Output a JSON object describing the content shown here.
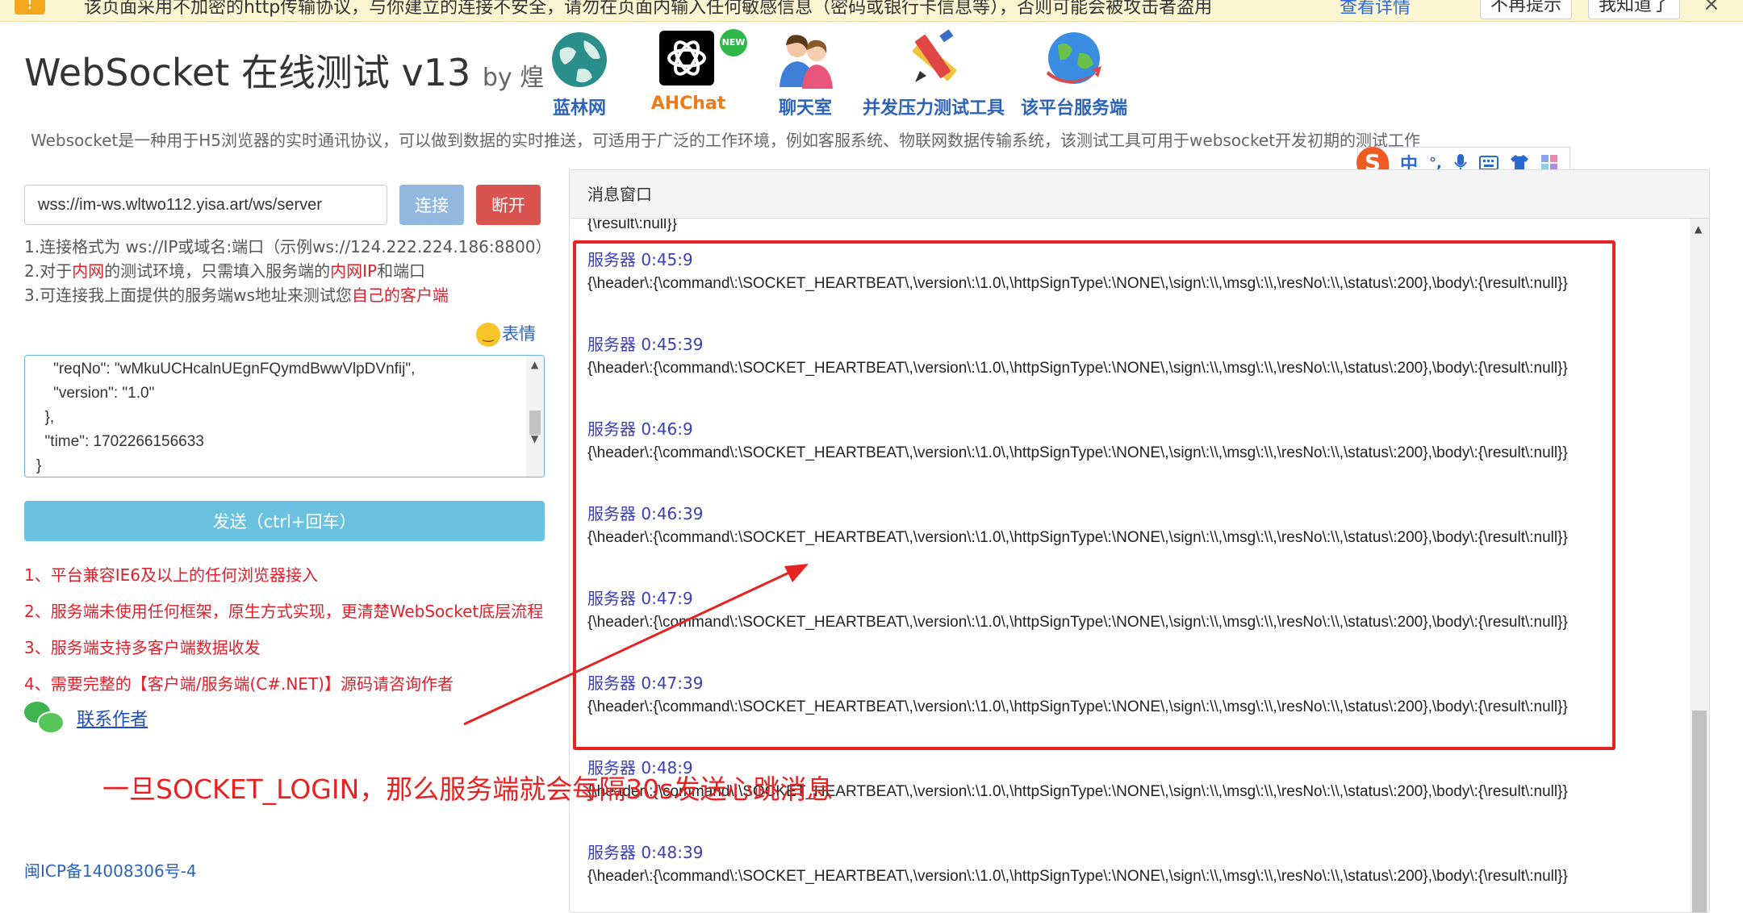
{
  "warning_bar": {
    "text": "该页面采用不加密的http传输协议，与你建立的连接不安全，请勿在页面内输入任何敏感信息（密码或银行卡信息等），否则可能会被攻击者盗用",
    "details_link": "查看详情",
    "no_remind_button": "不再提示",
    "got_it_button": "我知道了",
    "close_glyph": "×"
  },
  "header": {
    "title": "WebSocket 在线测试 v13",
    "by": "by 煌",
    "nav": [
      {
        "label": "蓝林网",
        "icon": "globe-icon"
      },
      {
        "label": "AHChat",
        "icon": "openai-logo-icon",
        "badge": "NEW"
      },
      {
        "label": "聊天室",
        "icon": "chat-people-icon"
      },
      {
        "label": "并发压力测试工具",
        "icon": "pencil-ruler-icon"
      },
      {
        "label": "该平台服务端",
        "icon": "globe-arrow-icon"
      }
    ],
    "description": "Websocket是一种用于H5浏览器的实时通讯协议，可以做到数据的实时推送，可适用于广泛的工作环境，例如客服系统、物联网数据传输系统，该测试工具可用于websocket开发初期的测试工作"
  },
  "ime": {
    "logo": "S",
    "mode": "中",
    "punct": "°,"
  },
  "connection": {
    "url": "wss://im-ws.wltwo112.yisa.art/ws/server",
    "connect_label": "连接",
    "disconnect_label": "断开"
  },
  "tips": {
    "line1": "1.连接格式为 ws://IP或域名:端口（示例ws://124.222.224.186:8800）",
    "line2_a": "2.对于",
    "line2_b": "内网",
    "line2_c": "的测试环境，只需填入服务端的",
    "line2_d": "内网IP",
    "line2_e": "和端口",
    "line3_a": "3.可连接我上面提供的服务端ws地址来测试您",
    "line3_b": "自己的客户端"
  },
  "emoji_label": "表情",
  "message_input": "    \"reqNo\": \"wMkuUCHcalnUEgnFQymdBwwVlpDVnfij\",\n    \"version\": \"1.0\"\n  },\n  \"time\": 1702266156633\n}",
  "send_label": "发送（ctrl+回车）",
  "features": [
    "1、平台兼容IE6及以上的任何浏览器接入",
    "2、服务端未使用任何框架，原生方式实现，更清楚WebSocket底层流程",
    "3、服务端支持多客户端数据收发",
    "4、需要完整的【客户端/服务端(C#.NET)】源码请咨询作者"
  ],
  "contact_label": "联系作者",
  "icp": "闽ICP备14008306号-4",
  "panel": {
    "title": "消息窗口",
    "partial_top": "{\\result\\:null}}",
    "messages": [
      {
        "time": "服务器 0:45:9",
        "body": "{\\header\\:{\\command\\:\\SOCKET_HEARTBEAT\\,\\version\\:\\1.0\\,\\httpSignType\\:\\NONE\\,\\sign\\:\\\\,\\msg\\:\\\\,\\resNo\\:\\\\,\\status\\:200},\\body\\:{\\result\\:null}}"
      },
      {
        "time": "服务器 0:45:39",
        "body": "{\\header\\:{\\command\\:\\SOCKET_HEARTBEAT\\,\\version\\:\\1.0\\,\\httpSignType\\:\\NONE\\,\\sign\\:\\\\,\\msg\\:\\\\,\\resNo\\:\\\\,\\status\\:200},\\body\\:{\\result\\:null}}"
      },
      {
        "time": "服务器 0:46:9",
        "body": "{\\header\\:{\\command\\:\\SOCKET_HEARTBEAT\\,\\version\\:\\1.0\\,\\httpSignType\\:\\NONE\\,\\sign\\:\\\\,\\msg\\:\\\\,\\resNo\\:\\\\,\\status\\:200},\\body\\:{\\result\\:null}}"
      },
      {
        "time": "服务器 0:46:39",
        "body": "{\\header\\:{\\command\\:\\SOCKET_HEARTBEAT\\,\\version\\:\\1.0\\,\\httpSignType\\:\\NONE\\,\\sign\\:\\\\,\\msg\\:\\\\,\\resNo\\:\\\\,\\status\\:200},\\body\\:{\\result\\:null}}"
      },
      {
        "time": "服务器 0:47:9",
        "body": "{\\header\\:{\\command\\:\\SOCKET_HEARTBEAT\\,\\version\\:\\1.0\\,\\httpSignType\\:\\NONE\\,\\sign\\:\\\\,\\msg\\:\\\\,\\resNo\\:\\\\,\\status\\:200},\\body\\:{\\result\\:null}}"
      },
      {
        "time": "服务器 0:47:39",
        "body": "{\\header\\:{\\command\\:\\SOCKET_HEARTBEAT\\,\\version\\:\\1.0\\,\\httpSignType\\:\\NONE\\,\\sign\\:\\\\,\\msg\\:\\\\,\\resNo\\:\\\\,\\status\\:200},\\body\\:{\\result\\:null}}"
      },
      {
        "time": "服务器 0:48:9",
        "body": "{\\header\\:{\\command\\:\\SOCKET_HEARTBEAT\\,\\version\\:\\1.0\\,\\httpSignType\\:\\NONE\\,\\sign\\:\\\\,\\msg\\:\\\\,\\resNo\\:\\\\,\\status\\:200},\\body\\:{\\result\\:null}}"
      },
      {
        "time": "服务器 0:48:39",
        "body": "{\\header\\:{\\command\\:\\SOCKET_HEARTBEAT\\,\\version\\:\\1.0\\,\\httpSignType\\:\\NONE\\,\\sign\\:\\\\,\\msg\\:\\\\,\\resNo\\:\\\\,\\status\\:200},\\body\\:{\\result\\:null}}"
      }
    ]
  },
  "annotation": {
    "text": "一旦SOCKET_LOGIN，那么服务端就会每隔30s发送心跳消息",
    "color": "#e62222"
  }
}
